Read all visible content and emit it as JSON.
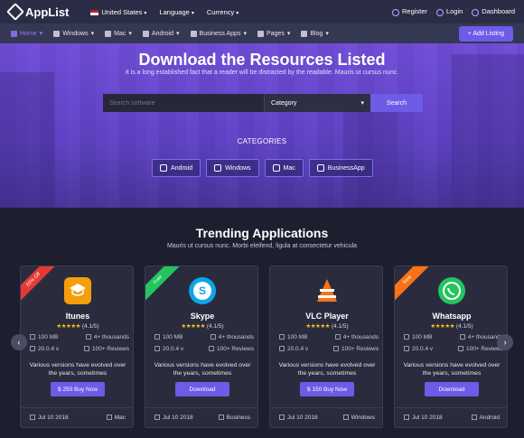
{
  "brand": {
    "name": "AppList"
  },
  "top_menu": {
    "country": "United States",
    "language": "Language",
    "currency": "Currency",
    "register": "Register",
    "login": "Login",
    "dashboard": "Dashboard"
  },
  "nav": {
    "items": [
      {
        "label": "Home",
        "icon": "home-icon"
      },
      {
        "label": "Windows",
        "icon": "windows-icon"
      },
      {
        "label": "Mac",
        "icon": "apple-icon"
      },
      {
        "label": "Android",
        "icon": "android-icon"
      },
      {
        "label": "Business Apps",
        "icon": "briefcase-icon"
      },
      {
        "label": "Pages",
        "icon": "pages-icon"
      },
      {
        "label": "Blog",
        "icon": "blog-icon"
      }
    ],
    "add_listing": "+ Add Listing"
  },
  "hero": {
    "title": "Download the Resources Listed",
    "subtitle": "It is a long established fact that a reader will be distracted by the readable. Mauris ut cursus nunc.",
    "search_placeholder": "Search software",
    "category_label": "Category",
    "search_button": "Search",
    "categories_title": "CATEGORIES",
    "categories": [
      {
        "label": "Android",
        "icon": "android-icon"
      },
      {
        "label": "Windows",
        "icon": "windows-icon"
      },
      {
        "label": "Mac",
        "icon": "apple-icon"
      },
      {
        "label": "BusinessApp",
        "icon": "briefcase-icon"
      }
    ]
  },
  "trending": {
    "title": "Trending Applications",
    "subtitle": "Mauris ut cursus nunc. Morbi eleifend, ligula at consectetur vehicula",
    "cards": [
      {
        "ribbon": "20% Off",
        "ribbon_color": "#e53935",
        "name": "Itunes",
        "icon": "itunes-icon",
        "icon_bg": "#f59e0b",
        "stars": "★★★★★",
        "rating": "(4.1/5)",
        "size": "100 MB",
        "downloads": "4+ thousands",
        "version": "20.0.4 v",
        "reviews": "100+ Reviews",
        "description": "Various versions have evolved over the years, sometimes",
        "button": "$ 250 Buy Now",
        "date": "Jul 10 2018",
        "platform": "Mac"
      },
      {
        "ribbon": "Free",
        "ribbon_color": "#22c55e",
        "name": "Skype",
        "icon": "skype-icon",
        "icon_bg": "#0ea5e9",
        "stars": "★★★★★",
        "rating": "(4.1/5)",
        "size": "100 MB",
        "downloads": "4+ thousands",
        "version": "20.0.4 v",
        "reviews": "100+ Reviews",
        "description": "Various versions have evolved over the years, sometimes",
        "button": "Download",
        "date": "Jul 10 2018",
        "platform": "Business"
      },
      {
        "ribbon": "",
        "ribbon_color": "",
        "name": "VLC Player",
        "icon": "vlc-icon",
        "icon_bg": "#2a2c3e",
        "stars": "★★★★★",
        "rating": "(4.1/5)",
        "size": "100 MB",
        "downloads": "4+ thousands",
        "version": "20.0.4 v",
        "reviews": "100+ Reviews",
        "description": "Various versions have evolved over the years, sometimes",
        "button": "$ 150 Buy Now",
        "date": "Jul 10 2018",
        "platform": "Windows"
      },
      {
        "ribbon": "New",
        "ribbon_color": "#f97316",
        "name": "Whatsapp",
        "icon": "whatsapp-icon",
        "icon_bg": "#22c55e",
        "stars": "★★★★★",
        "rating": "(4.1/5)",
        "size": "100 MB",
        "downloads": "4+ thousands",
        "version": "20.0.4 v",
        "reviews": "100+ Reviews",
        "description": "Various versions have evolved over the years, sometimes",
        "button": "Download",
        "date": "Jul 10 2018",
        "platform": "Android"
      }
    ]
  },
  "colors": {
    "accent": "#6c5ce7",
    "background": "#1d1f2e",
    "card": "#2a2c3e"
  }
}
